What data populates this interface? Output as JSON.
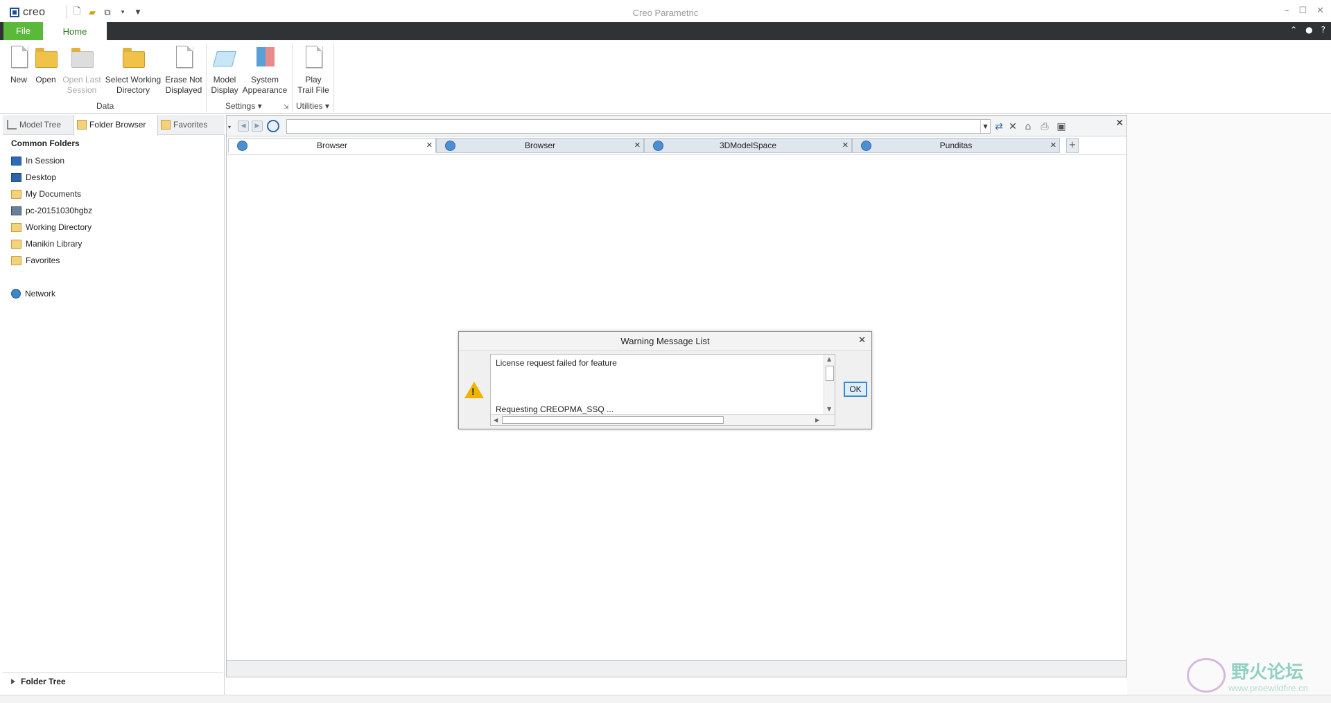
{
  "app": {
    "logo": "creo",
    "title": "Creo Parametric"
  },
  "ribbon_tabs": {
    "file": "File",
    "home": "Home"
  },
  "ribbon": {
    "new": "New",
    "open": "Open",
    "open_last_1": "Open Last",
    "open_last_2": "Session",
    "select_wd_1": "Select Working",
    "select_wd_2": "Directory",
    "erase_1": "Erase Not",
    "erase_2": "Displayed",
    "model_display_1": "Model",
    "model_display_2": "Display",
    "system_app_1": "System",
    "system_app_2": "Appearance",
    "play_1": "Play",
    "play_2": "Trail File",
    "group_data": "Data",
    "group_settings": "Settings",
    "group_utilities": "Utilities"
  },
  "panel": {
    "tabs": [
      "Model Tree",
      "Folder Browser",
      "Favorites"
    ],
    "common_folders": "Common Folders",
    "folders": [
      "In Session",
      "Desktop",
      "My Documents",
      "pc-20151030hgbz",
      "Working Directory",
      "Manikin Library",
      "Favorites"
    ],
    "network": "Network",
    "folder_tree": "Folder Tree"
  },
  "browser": {
    "address": "",
    "tabs": [
      "Browser",
      "Browser",
      "3DModelSpace",
      "Punditas"
    ]
  },
  "dialog": {
    "title": "Warning Message List",
    "line1": "License request failed for feature",
    "line2": "Requesting CREOPMA_SSQ ...",
    "ok": "OK"
  },
  "watermark": {
    "text": "野火论坛",
    "url": "www.proewildfire.cn"
  },
  "colors": {
    "file_tab": "#5ab83b",
    "home_tab_text": "#2a7a1e",
    "ribbon_tabbar": "#2f3336",
    "warning": "#f0b400",
    "ok_border": "#3c8ad0"
  }
}
